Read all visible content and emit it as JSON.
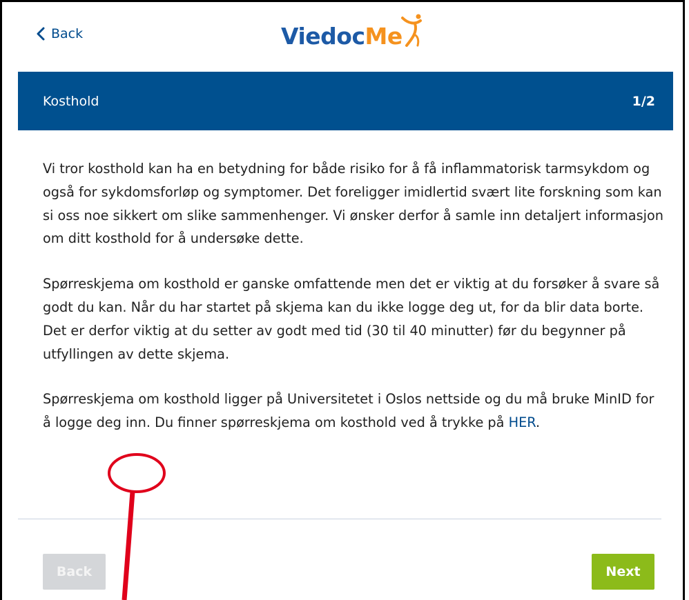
{
  "nav": {
    "back_label": "Back",
    "logo_text_main": "Viedoc",
    "logo_text_accent": "Me"
  },
  "header": {
    "title": "Kosthold",
    "progress": "1/2"
  },
  "content": {
    "paragraph1": "Vi tror kosthold kan ha en betydning for både risiko for å få inflammatorisk tarmsykdom og også for sykdomsforløp og symptomer. Det foreligger imidlertid svært lite forskning som kan si oss noe sikkert om slike sammenhenger. Vi ønsker derfor å samle inn detaljert informasjon om ditt kosthold for å undersøke dette.",
    "paragraph2": "Spørreskjema om kosthold er ganske omfattende men det er viktig at du forsøker å svare så godt du kan. Når du har startet på skjema kan du ikke logge deg ut, for da blir data borte. Det er derfor viktig at du setter av godt med tid (30 til 40 minutter) før du begynner på utfyllingen av dette skjema.",
    "paragraph3_before_link": "Spørreskjema om kosthold ligger på Universitetet i Oslos nettside og du må bruke MinID for å logge deg inn. Du finner spørreskjema om kosthold ved å trykke på ",
    "paragraph3_link": "HER",
    "paragraph3_after_link": "."
  },
  "footer": {
    "back_button": "Back",
    "next_button": "Next"
  },
  "colors": {
    "header_bg": "#00508f",
    "link": "#004b8d",
    "next_button": "#8cbb1a",
    "back_button_disabled": "#d4d6d9",
    "annotation": "#e0001b"
  }
}
